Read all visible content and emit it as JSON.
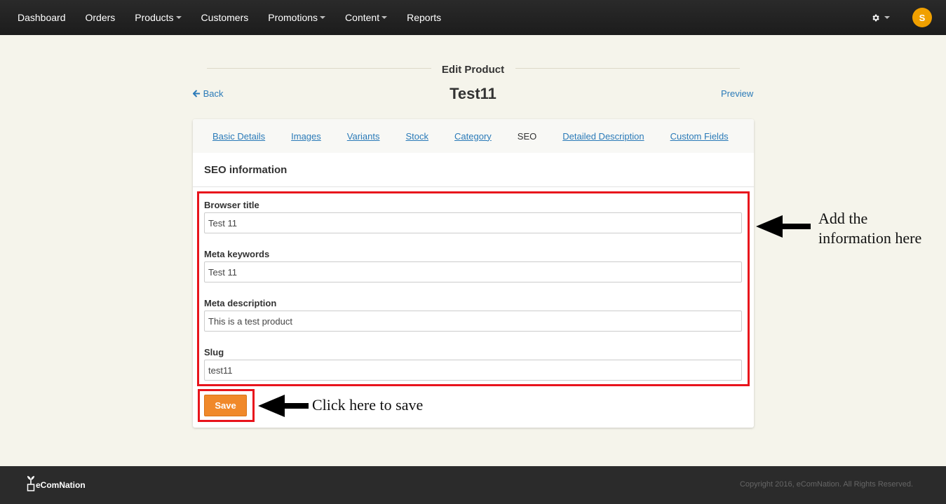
{
  "nav": {
    "items": [
      {
        "label": "Dashboard",
        "dropdown": false
      },
      {
        "label": "Orders",
        "dropdown": false
      },
      {
        "label": "Products",
        "dropdown": true
      },
      {
        "label": "Customers",
        "dropdown": false
      },
      {
        "label": "Promotions",
        "dropdown": true
      },
      {
        "label": "Content",
        "dropdown": true
      },
      {
        "label": "Reports",
        "dropdown": false
      }
    ],
    "settings_icon": "gear-icon",
    "avatar_initial": "S",
    "avatar_color": "#f0a000"
  },
  "page": {
    "heading": "Edit Product",
    "back_label": "Back",
    "product_title": "Test11",
    "preview_label": "Preview"
  },
  "tabs": [
    {
      "label": "Basic Details",
      "active": false
    },
    {
      "label": "Images",
      "active": false
    },
    {
      "label": "Variants",
      "active": false
    },
    {
      "label": "Stock",
      "active": false
    },
    {
      "label": "Category",
      "active": false
    },
    {
      "label": "SEO",
      "active": true
    },
    {
      "label": "Detailed Description",
      "active": false
    },
    {
      "label": "Custom Fields",
      "active": false
    }
  ],
  "seo": {
    "heading": "SEO information",
    "fields": [
      {
        "label": "Browser title",
        "value": "Test 11"
      },
      {
        "label": "Meta keywords",
        "value": "Test 11"
      },
      {
        "label": "Meta description",
        "value": "This is a test product"
      },
      {
        "label": "Slug",
        "value": "test11"
      }
    ],
    "save_label": "Save"
  },
  "annotations": {
    "info_text_line1": "Add the",
    "info_text_line2": "information here",
    "save_text": "Click here to save",
    "highlight_color": "#e8141c"
  },
  "footer": {
    "brand": "eComNation",
    "copyright": "Copyright 2016, eComNation. All Rights Reserved."
  },
  "colors": {
    "accent": "#f0892a",
    "link": "#2a7ab8",
    "background": "#f5f4eb"
  }
}
